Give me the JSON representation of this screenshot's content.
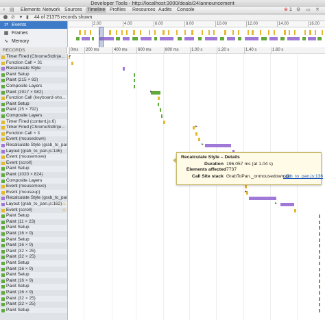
{
  "window": {
    "title": "Developer Tools - http://localhost:3000/deals/24/announcement"
  },
  "toolbar": {
    "tabs": [
      {
        "label": "Elements"
      },
      {
        "label": "Network"
      },
      {
        "label": "Sources"
      },
      {
        "label": "Timeline",
        "active": true
      },
      {
        "label": "Profiles"
      },
      {
        "label": "Resources"
      },
      {
        "label": "Audits"
      },
      {
        "label": "Console"
      }
    ],
    "icons": [
      "search-icon",
      "console-icon"
    ],
    "right_icons": [
      "error-badge-icon",
      "settings-icon",
      "dock-icon",
      "close-icon"
    ],
    "error_count": "1"
  },
  "subbar": {
    "records_shown": "44 of 21375 records shown"
  },
  "sidebar": {
    "items": [
      {
        "label": "Events",
        "active": true
      },
      {
        "label": "Frames"
      },
      {
        "label": "Memory"
      }
    ]
  },
  "overview": {
    "ticks": [
      "2.00",
      "4.00",
      "6.00",
      "8.00",
      "10.00",
      "12.00",
      "14.00",
      "16.00"
    ]
  },
  "records": {
    "header": "RECORDS",
    "ruler_ticks": [
      "0ms",
      "200 ms",
      "400 ms",
      "600 ms",
      "800 ms",
      "1.00 s",
      "1.20 s",
      "1.40 s",
      "1.60 s"
    ],
    "rows": [
      {
        "name": "Timer Fired",
        "detail": "(ChromeStdInje...",
        "color": "#e4b82f"
      },
      {
        "name": "Function Call",
        "detail": "× 31",
        "color": "#e4b82f"
      },
      {
        "name": "Recalculate Style",
        "detail": "",
        "color": "#9f78d8"
      },
      {
        "name": "Paint Setup",
        "detail": "",
        "color": "#5faa3b"
      },
      {
        "name": "Paint",
        "detail": "(215 × 83)",
        "color": "#5faa3b"
      },
      {
        "name": "Composite Layers",
        "detail": "",
        "color": "#5faa3b"
      },
      {
        "name": "Paint",
        "detail": "(1917 × 982)",
        "color": "#5faa3b"
      },
      {
        "name": "Function Call",
        "detail": "(keyboard-sho...",
        "color": "#e4b82f"
      },
      {
        "name": "Paint Setup",
        "detail": "",
        "color": "#5faa3b"
      },
      {
        "name": "Paint",
        "detail": "(15 × 792)",
        "color": "#5faa3b"
      },
      {
        "name": "Composite Layers",
        "detail": "",
        "color": "#5faa3b"
      },
      {
        "name": "Timer Fired",
        "detail": "(content.js:6)",
        "color": "#e4b82f"
      },
      {
        "name": "Timer Fired",
        "detail": "(ChromeStdInje...",
        "color": "#e4b82f"
      },
      {
        "name": "Function Call",
        "detail": "× 3",
        "color": "#e4b82f"
      },
      {
        "name": "Event",
        "detail": "(mousedown)",
        "color": "#e4b82f"
      },
      {
        "name": "Recalculate Style",
        "detail": "(grab_to_pan.js",
        "color": "#9f78d8"
      },
      {
        "name": "Layout",
        "detail": "(grab_to_pan.js:136)",
        "color": "#9f78d8"
      },
      {
        "name": "Event",
        "detail": "(mousemove)",
        "color": "#e4b82f"
      },
      {
        "name": "Event",
        "detail": "(scroll)",
        "color": "#e4b82f"
      },
      {
        "name": "Paint Setup",
        "detail": "",
        "color": "#5faa3b"
      },
      {
        "name": "Paint",
        "detail": "(1020 × 824)",
        "color": "#5faa3b"
      },
      {
        "name": "Composite Layers",
        "detail": "",
        "color": "#5faa3b"
      },
      {
        "name": "Event",
        "detail": "(mousemove)",
        "color": "#e4b82f"
      },
      {
        "name": "Event",
        "detail": "(mouseup)",
        "color": "#e4b82f"
      },
      {
        "name": "Recalculate Style",
        "detail": "(grab_to_pan...",
        "color": "#9f78d8"
      },
      {
        "name": "Layout",
        "detail": "(grab_to_pan.js:162)",
        "color": "#9f78d8",
        "warn": true
      },
      {
        "name": "Event",
        "detail": "(scroll)",
        "color": "#e4b82f",
        "warn": true
      },
      {
        "name": "Paint Setup",
        "detail": "",
        "color": "#5faa3b"
      },
      {
        "name": "Paint",
        "detail": "(11 × 23)",
        "color": "#5faa3b"
      },
      {
        "name": "Paint Setup",
        "detail": "",
        "color": "#5faa3b"
      },
      {
        "name": "Paint",
        "detail": "(16 × 9)",
        "color": "#5faa3b"
      },
      {
        "name": "Paint Setup",
        "detail": "",
        "color": "#5faa3b"
      },
      {
        "name": "Paint",
        "detail": "(16 × 9)",
        "color": "#5faa3b"
      },
      {
        "name": "Paint",
        "detail": "(32 × 25)",
        "color": "#5faa3b"
      },
      {
        "name": "Paint",
        "detail": "(32 × 25)",
        "color": "#5faa3b"
      },
      {
        "name": "Paint Setup",
        "detail": "",
        "color": "#5faa3b"
      },
      {
        "name": "Paint",
        "detail": "(16 × 9)",
        "color": "#5faa3b"
      },
      {
        "name": "Paint Setup",
        "detail": "",
        "color": "#5faa3b"
      },
      {
        "name": "Paint",
        "detail": "(16 × 9)",
        "color": "#5faa3b"
      },
      {
        "name": "Paint Setup",
        "detail": "",
        "color": "#5faa3b"
      },
      {
        "name": "Paint",
        "detail": "(16 × 9)",
        "color": "#5faa3b"
      },
      {
        "name": "Paint",
        "detail": "(32 × 25)",
        "color": "#5faa3b"
      },
      {
        "name": "Paint",
        "detail": "(32 × 25)",
        "color": "#5faa3b"
      },
      {
        "name": "Paint Setup",
        "detail": "",
        "color": "#5faa3b"
      }
    ]
  },
  "popover": {
    "title": "Recalculate Style – Details",
    "duration_label": "Duration",
    "duration_value": "196.057 ms (at 1.04 s)",
    "elements_label": "Elements affected",
    "elements_value": "7737",
    "callsite_label": "Call Site stack",
    "callsite_fn": "GrabToPan._onmousedown @",
    "callsite_link": "grab_to_pan.js:136"
  }
}
